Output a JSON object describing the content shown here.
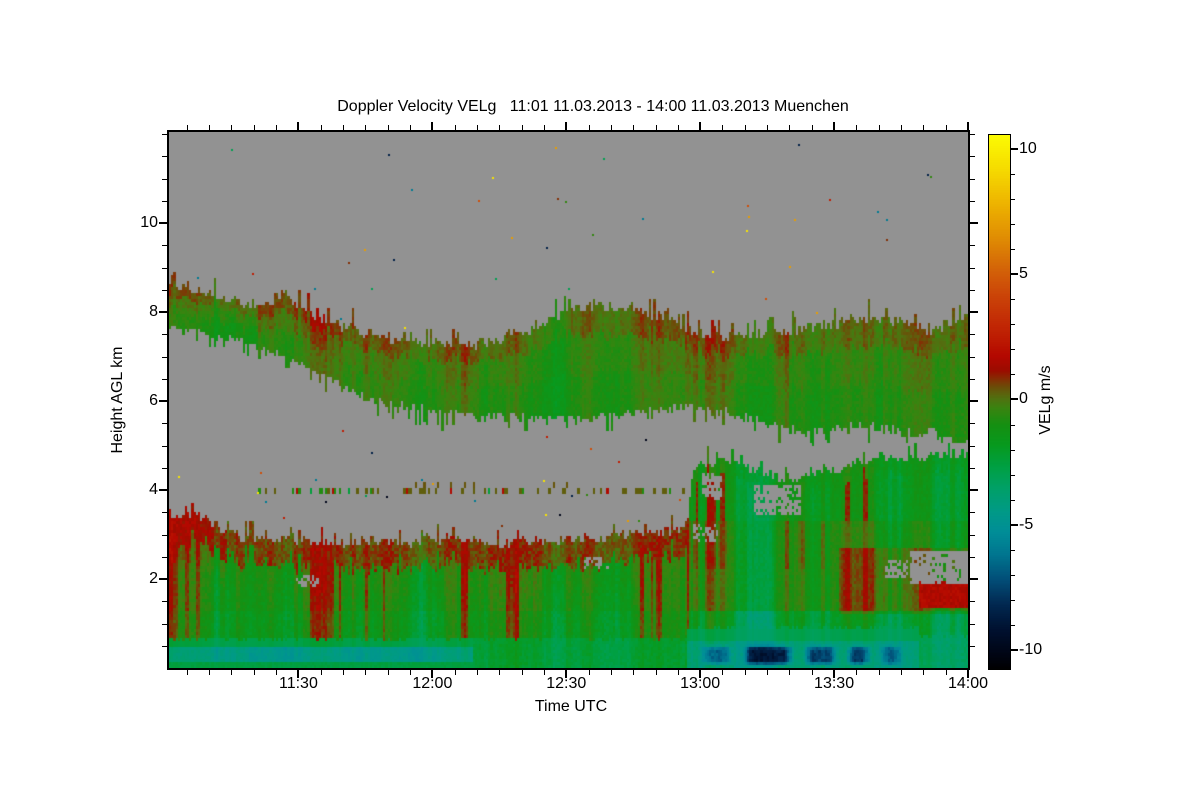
{
  "page": {
    "background": "#ffffff"
  },
  "chart_data": {
    "type": "heatmap",
    "title": "Doppler Velocity VELg   11:01 11.03.2013 - 14:00 11.03.2013 Muenchen",
    "xlabel": "Time UTC",
    "ylabel": "Height AGL km",
    "colorbar_label": "VELg m/s",
    "site": "Muenchen",
    "time_start": "11:01 11.03.2013",
    "time_end": "14:00 11.03.2013",
    "x_axis": {
      "start_label": "11:01",
      "range_minutes": [
        0,
        179
      ],
      "major_ticks": [
        {
          "minute": 29,
          "label": "11:30"
        },
        {
          "minute": 59,
          "label": "12:00"
        },
        {
          "minute": 89,
          "label": "12:30"
        },
        {
          "minute": 119,
          "label": "13:00"
        },
        {
          "minute": 149,
          "label": "13:30"
        },
        {
          "minute": 179,
          "label": "14:00"
        }
      ],
      "minor_step_minutes": 5
    },
    "y_axis": {
      "range_km": [
        0,
        12.05
      ],
      "major_ticks": [
        2,
        4,
        6,
        8,
        10
      ],
      "minor_step_km": 0.5
    },
    "colorbar": {
      "range": [
        -10.75,
        10.55
      ],
      "major_ticks": [
        10,
        5,
        0,
        -5,
        -10
      ],
      "minor_step": 1,
      "stops": [
        [
          10.55,
          "#fcfc04"
        ],
        [
          9.2,
          "#f6dc00"
        ],
        [
          7.8,
          "#eeb400"
        ],
        [
          6.4,
          "#e08c04"
        ],
        [
          5.2,
          "#d46408"
        ],
        [
          4.2,
          "#cc4608"
        ],
        [
          3.2,
          "#c42e06"
        ],
        [
          2.3,
          "#bc1802"
        ],
        [
          1.7,
          "#b40800"
        ],
        [
          1.15,
          "#9c0c00"
        ],
        [
          0.85,
          "#882a04"
        ],
        [
          0.55,
          "#704808"
        ],
        [
          0.3,
          "#605e0c"
        ],
        [
          0.05,
          "#527010"
        ],
        [
          -0.35,
          "#3a8410"
        ],
        [
          -1,
          "#169012"
        ],
        [
          -1.8,
          "#089a1e"
        ],
        [
          -2.7,
          "#00a044"
        ],
        [
          -3.6,
          "#00a06a"
        ],
        [
          -4.5,
          "#009a88"
        ],
        [
          -5.3,
          "#008e98"
        ],
        [
          -6.2,
          "#007690"
        ],
        [
          -7.2,
          "#024e78"
        ],
        [
          -8.2,
          "#022850"
        ],
        [
          -9.2,
          "#001130"
        ],
        [
          -10.2,
          "#000514"
        ],
        [
          -10.75,
          "#000002"
        ]
      ]
    },
    "nodata_color": "#929292",
    "layers": {
      "upper_cloud": {
        "profile": [
          [
            0,
            8.62,
            7.75
          ],
          [
            6,
            8.5,
            7.55
          ],
          [
            12,
            8.32,
            7.42
          ],
          [
            18,
            8.2,
            7.3
          ],
          [
            24,
            8.12,
            7.1
          ],
          [
            26,
            8.6,
            7.05
          ],
          [
            28,
            8.15,
            6.95
          ],
          [
            33,
            7.9,
            6.7
          ],
          [
            39,
            7.68,
            6.35
          ],
          [
            45,
            7.5,
            6.05
          ],
          [
            51,
            7.38,
            5.92
          ],
          [
            57,
            7.3,
            5.82
          ],
          [
            63,
            7.28,
            5.75
          ],
          [
            69,
            7.3,
            5.7
          ],
          [
            75,
            7.42,
            5.66
          ],
          [
            81,
            7.62,
            5.6
          ],
          [
            87,
            7.95,
            5.6
          ],
          [
            93,
            8.12,
            5.63
          ],
          [
            99,
            8.15,
            5.68
          ],
          [
            105,
            8.05,
            5.74
          ],
          [
            111,
            7.9,
            5.8
          ],
          [
            116,
            7.62,
            5.85
          ],
          [
            120,
            7.48,
            5.82
          ],
          [
            126,
            7.42,
            5.74
          ],
          [
            131,
            7.5,
            5.58
          ],
          [
            137,
            7.56,
            5.42
          ],
          [
            143,
            7.64,
            5.28
          ],
          [
            149,
            7.74,
            5.4
          ],
          [
            155,
            7.86,
            5.5
          ],
          [
            161,
            7.8,
            5.36
          ],
          [
            167,
            7.7,
            5.28
          ],
          [
            171,
            7.6,
            5.34
          ],
          [
            175,
            7.74,
            5.18
          ],
          [
            179,
            7.96,
            5.05
          ]
        ],
        "v_top": 0.45,
        "v_mid": -0.15,
        "v_low": -0.45,
        "streak_amp": 0.55,
        "left_bias": 0.3
      },
      "lower_layer": {
        "top_profile": [
          [
            0,
            3.28
          ],
          [
            4,
            3.5
          ],
          [
            8,
            3.38
          ],
          [
            12,
            3.08
          ],
          [
            16,
            2.95
          ],
          [
            24,
            2.9
          ],
          [
            32,
            2.86
          ],
          [
            40,
            2.82
          ],
          [
            48,
            2.86
          ],
          [
            56,
            2.82
          ],
          [
            64,
            2.86
          ],
          [
            72,
            2.82
          ],
          [
            80,
            2.84
          ],
          [
            88,
            2.88
          ],
          [
            96,
            2.92
          ],
          [
            104,
            3.0
          ],
          [
            110,
            3.06
          ],
          [
            114,
            3.14
          ],
          [
            116,
            3.22
          ],
          [
            117.5,
            4.5
          ],
          [
            121,
            4.62
          ],
          [
            125,
            4.66
          ],
          [
            129,
            4.54
          ],
          [
            133,
            4.4
          ],
          [
            137,
            4.28
          ],
          [
            141,
            4.24
          ],
          [
            145,
            4.36
          ],
          [
            149,
            4.46
          ],
          [
            153,
            4.6
          ],
          [
            157,
            4.72
          ],
          [
            161,
            4.78
          ],
          [
            165,
            4.72
          ],
          [
            169,
            4.7
          ],
          [
            173,
            4.78
          ],
          [
            179,
            4.86
          ]
        ],
        "fringe_v": 0.7,
        "interior_v": -0.9,
        "right_interior_v": -0.9,
        "holes": [
          [
            131,
            141.5,
            3.42,
            4.1,
            0.75
          ],
          [
            119.5,
            124,
            3.8,
            4.4,
            0.6
          ],
          [
            166,
            179,
            1.92,
            2.62,
            0.9
          ],
          [
            160.5,
            165.5,
            2.05,
            2.45,
            0.65
          ],
          [
            28.5,
            33.5,
            1.82,
            2.1,
            0.55
          ],
          [
            93,
            99,
            2.2,
            2.5,
            0.45
          ],
          [
            117.5,
            123,
            2.85,
            3.25,
            0.5
          ]
        ],
        "orange_blotch": {
          "t_range": [
            168,
            179
          ],
          "h_range": [
            1.35,
            1.95
          ],
          "v": 1.6
        }
      },
      "bottom_band": {
        "segments": [
          [
            0,
            68,
            -4.0
          ],
          [
            68,
            116,
            -2.3
          ],
          [
            116,
            168,
            -4.0
          ],
          [
            168,
            179,
            -3.1
          ]
        ],
        "top_km_left": 0.66,
        "top_km_mid": 0.9,
        "top_km_right": 0.72,
        "dark_patches": [
          [
            119,
            126.5,
            -6.8
          ],
          [
            128.5,
            140,
            -8.6
          ],
          [
            142,
            150,
            -7.4
          ],
          [
            151.5,
            157.5,
            -8.0
          ],
          [
            159,
            164.5,
            -6.6
          ]
        ]
      },
      "noise_line": {
        "height_km": 3.97,
        "t_range": [
          17,
          116
        ],
        "density": 0.3,
        "second_line": {
          "height_km": 4.12,
          "t_range": [
            55,
            90
          ],
          "density": 0.07
        }
      },
      "speckles": {
        "count": 95,
        "values": [
          9.5,
          7,
          4.5,
          2.5,
          0.8,
          -0.5,
          -3,
          -6,
          -8.5,
          -10
        ]
      }
    }
  }
}
